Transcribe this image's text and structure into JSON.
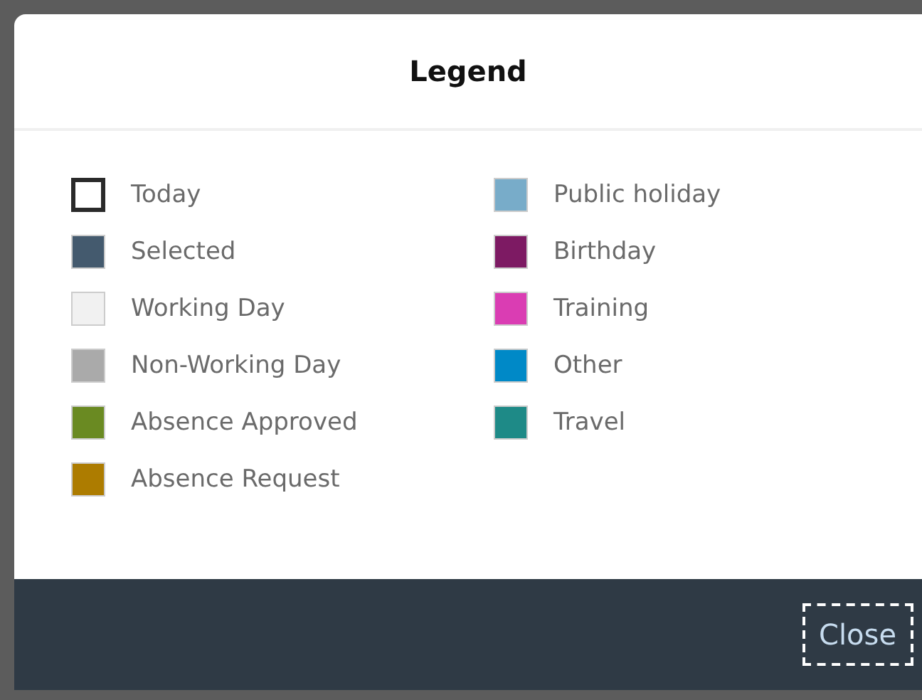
{
  "dialog": {
    "title": "Legend"
  },
  "columns": [
    [
      {
        "label": "Today",
        "kind": "outline",
        "color": "#2a2a2a"
      },
      {
        "label": "Selected",
        "kind": "fill",
        "color": "#445a6e"
      },
      {
        "label": "Working Day",
        "kind": "fill",
        "color": "#f1f1f1"
      },
      {
        "label": "Non-Working Day",
        "kind": "fill",
        "color": "#aaaaaa"
      },
      {
        "label": "Absence Approved",
        "kind": "fill",
        "color": "#6a8a22"
      },
      {
        "label": "Absence Request",
        "kind": "fill",
        "color": "#ad7c00"
      }
    ],
    [
      {
        "label": "Public holiday",
        "kind": "fill",
        "color": "#78acc9"
      },
      {
        "label": "Birthday",
        "kind": "fill",
        "color": "#7d1a63"
      },
      {
        "label": "Training",
        "kind": "fill",
        "color": "#da3db3"
      },
      {
        "label": "Other",
        "kind": "fill",
        "color": "#0089c7"
      },
      {
        "label": "Travel",
        "kind": "fill",
        "color": "#1e8a87"
      }
    ]
  ],
  "footer": {
    "button": "Close"
  }
}
